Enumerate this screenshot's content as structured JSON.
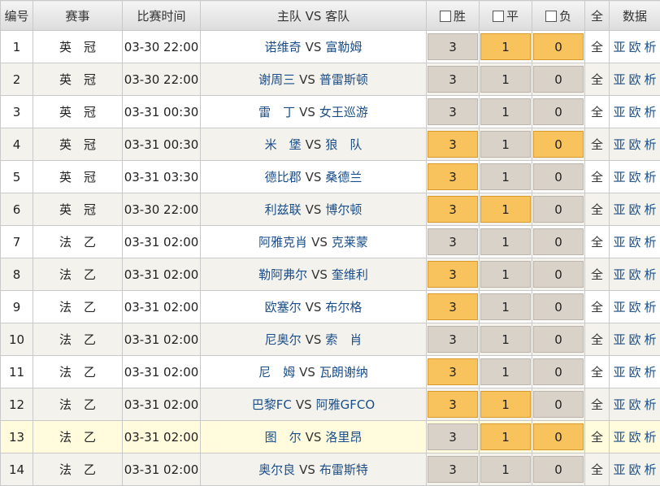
{
  "header": {
    "num": "编号",
    "league": "赛事",
    "time": "比赛时间",
    "teams": "主队 VS 客队",
    "win": "胜",
    "draw": "平",
    "loss": "负",
    "all": "全",
    "data": "数据"
  },
  "vs_label": "VS",
  "links": {
    "all": "全",
    "asia": "亚",
    "europe": "欧",
    "analysis": "析"
  },
  "rows": [
    {
      "num": "1",
      "league": "英　冠",
      "time": "03-30 22:00",
      "home": "诺维奇",
      "away": "富勒姆",
      "win": "3",
      "draw": "1",
      "loss": "0",
      "sel": {
        "win": false,
        "draw": true,
        "loss": true
      }
    },
    {
      "num": "2",
      "league": "英　冠",
      "time": "03-30 22:00",
      "home": "谢周三",
      "away": "普雷斯顿",
      "win": "3",
      "draw": "1",
      "loss": "0",
      "sel": {
        "win": false,
        "draw": false,
        "loss": false
      }
    },
    {
      "num": "3",
      "league": "英　冠",
      "time": "03-31 00:30",
      "home": "雷　丁",
      "away": "女王巡游",
      "win": "3",
      "draw": "1",
      "loss": "0",
      "sel": {
        "win": false,
        "draw": false,
        "loss": false
      }
    },
    {
      "num": "4",
      "league": "英　冠",
      "time": "03-31 00:30",
      "home": "米　堡",
      "away": "狼　队",
      "win": "3",
      "draw": "1",
      "loss": "0",
      "sel": {
        "win": true,
        "draw": false,
        "loss": true
      }
    },
    {
      "num": "5",
      "league": "英　冠",
      "time": "03-31 03:30",
      "home": "德比郡",
      "away": "桑德兰",
      "win": "3",
      "draw": "1",
      "loss": "0",
      "sel": {
        "win": true,
        "draw": false,
        "loss": false
      }
    },
    {
      "num": "6",
      "league": "英　冠",
      "time": "03-30 22:00",
      "home": "利兹联",
      "away": "博尔顿",
      "win": "3",
      "draw": "1",
      "loss": "0",
      "sel": {
        "win": true,
        "draw": true,
        "loss": false
      }
    },
    {
      "num": "7",
      "league": "法　乙",
      "time": "03-31 02:00",
      "home": "阿雅克肖",
      "away": "克莱蒙",
      "win": "3",
      "draw": "1",
      "loss": "0",
      "sel": {
        "win": false,
        "draw": false,
        "loss": false
      }
    },
    {
      "num": "8",
      "league": "法　乙",
      "time": "03-31 02:00",
      "home": "勒阿弗尔",
      "away": "奎维利",
      "win": "3",
      "draw": "1",
      "loss": "0",
      "sel": {
        "win": true,
        "draw": false,
        "loss": false
      }
    },
    {
      "num": "9",
      "league": "法　乙",
      "time": "03-31 02:00",
      "home": "欧塞尔",
      "away": "布尔格",
      "win": "3",
      "draw": "1",
      "loss": "0",
      "sel": {
        "win": true,
        "draw": false,
        "loss": false
      }
    },
    {
      "num": "10",
      "league": "法　乙",
      "time": "03-31 02:00",
      "home": "尼奥尔",
      "away": "索　肖",
      "win": "3",
      "draw": "1",
      "loss": "0",
      "sel": {
        "win": false,
        "draw": false,
        "loss": false
      }
    },
    {
      "num": "11",
      "league": "法　乙",
      "time": "03-31 02:00",
      "home": "尼　姆",
      "away": "瓦朗谢纳",
      "win": "3",
      "draw": "1",
      "loss": "0",
      "sel": {
        "win": true,
        "draw": false,
        "loss": false
      }
    },
    {
      "num": "12",
      "league": "法　乙",
      "time": "03-31 02:00",
      "home": "巴黎FC",
      "away": "阿雅GFCO",
      "win": "3",
      "draw": "1",
      "loss": "0",
      "sel": {
        "win": true,
        "draw": true,
        "loss": false
      }
    },
    {
      "num": "13",
      "league": "法　乙",
      "time": "03-31 02:00",
      "home": "图　尔",
      "away": "洛里昂",
      "win": "3",
      "draw": "1",
      "loss": "0",
      "sel": {
        "win": false,
        "draw": true,
        "loss": true
      },
      "highlight": true
    },
    {
      "num": "14",
      "league": "法　乙",
      "time": "03-31 02:00",
      "home": "奥尔良",
      "away": "布雷斯特",
      "win": "3",
      "draw": "1",
      "loss": "0",
      "sel": {
        "win": false,
        "draw": false,
        "loss": false
      }
    }
  ],
  "colors": {
    "selected_odd": "#f8c25c",
    "unselected_odd": "#d9d2c9",
    "team_link": "#1a4e8a",
    "row_alt": "#f4f2ec",
    "row_highlight": "#fffbdc"
  }
}
